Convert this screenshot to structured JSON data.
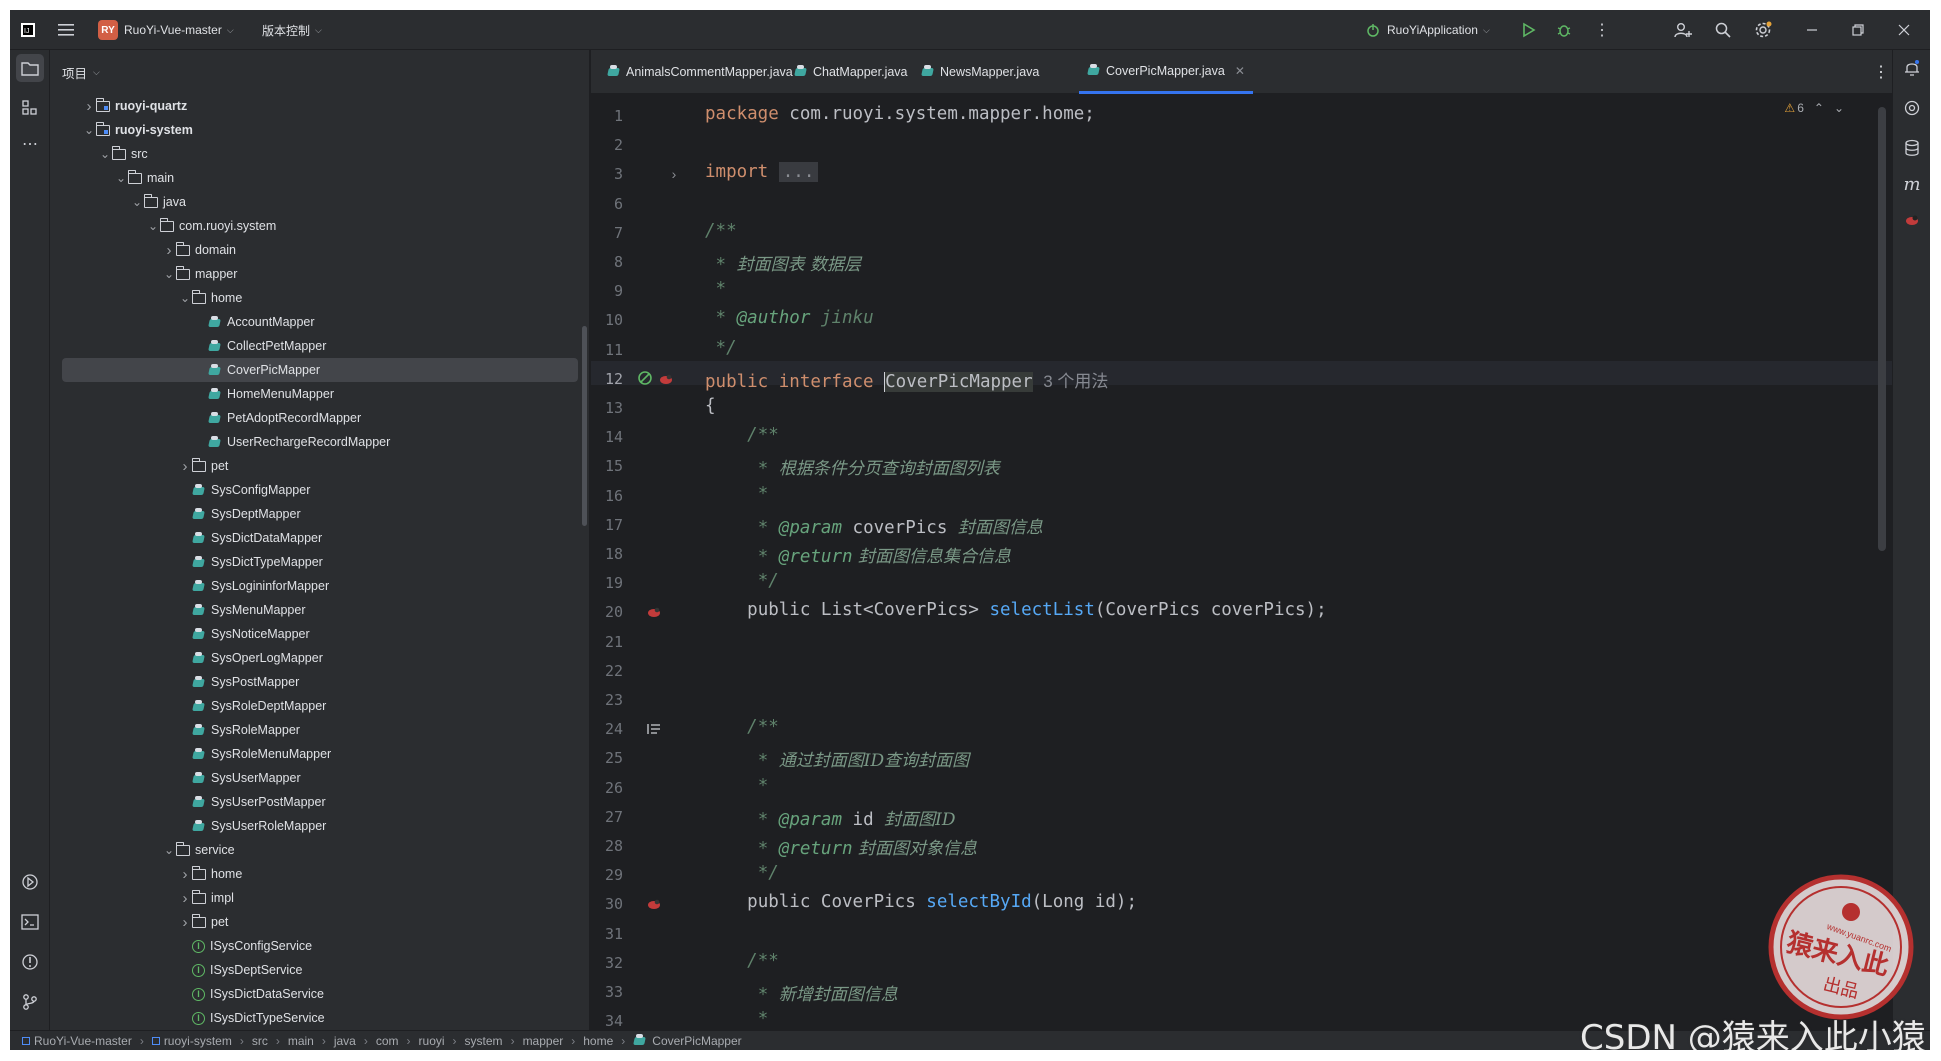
{
  "titlebar": {
    "project_badge": "RY",
    "project_name": "RuoYi-Vue-master",
    "vcs": "版本控制",
    "run_config": "RuoYiApplication"
  },
  "sidebar": {
    "title": "项目"
  },
  "tree": [
    {
      "label": "ruoyi-quartz",
      "depth": 1,
      "kind": "module",
      "arrow": "right",
      "bold": true
    },
    {
      "label": "ruoyi-system",
      "depth": 1,
      "kind": "module",
      "arrow": "down",
      "bold": true
    },
    {
      "label": "src",
      "depth": 2,
      "kind": "folder",
      "arrow": "down"
    },
    {
      "label": "main",
      "depth": 3,
      "kind": "folder",
      "arrow": "down"
    },
    {
      "label": "java",
      "depth": 4,
      "kind": "folder",
      "arrow": "down"
    },
    {
      "label": "com.ruoyi.system",
      "depth": 5,
      "kind": "folder",
      "arrow": "down"
    },
    {
      "label": "domain",
      "depth": 6,
      "kind": "folder",
      "arrow": "right"
    },
    {
      "label": "mapper",
      "depth": 6,
      "kind": "folder",
      "arrow": "down"
    },
    {
      "label": "home",
      "depth": 7,
      "kind": "folder",
      "arrow": "down"
    },
    {
      "label": "AccountMapper",
      "depth": 8,
      "kind": "mapper"
    },
    {
      "label": "CollectPetMapper",
      "depth": 8,
      "kind": "mapper"
    },
    {
      "label": "CoverPicMapper",
      "depth": 8,
      "kind": "mapper",
      "selected": true
    },
    {
      "label": "HomeMenuMapper",
      "depth": 8,
      "kind": "mapper"
    },
    {
      "label": "PetAdoptRecordMapper",
      "depth": 8,
      "kind": "mapper"
    },
    {
      "label": "UserRechargeRecordMapper",
      "depth": 8,
      "kind": "mapper"
    },
    {
      "label": "pet",
      "depth": 7,
      "kind": "folder",
      "arrow": "right"
    },
    {
      "label": "SysConfigMapper",
      "depth": 7,
      "kind": "mapper"
    },
    {
      "label": "SysDeptMapper",
      "depth": 7,
      "kind": "mapper"
    },
    {
      "label": "SysDictDataMapper",
      "depth": 7,
      "kind": "mapper"
    },
    {
      "label": "SysDictTypeMapper",
      "depth": 7,
      "kind": "mapper"
    },
    {
      "label": "SysLogininforMapper",
      "depth": 7,
      "kind": "mapper"
    },
    {
      "label": "SysMenuMapper",
      "depth": 7,
      "kind": "mapper"
    },
    {
      "label": "SysNoticeMapper",
      "depth": 7,
      "kind": "mapper"
    },
    {
      "label": "SysOperLogMapper",
      "depth": 7,
      "kind": "mapper"
    },
    {
      "label": "SysPostMapper",
      "depth": 7,
      "kind": "mapper"
    },
    {
      "label": "SysRoleDeptMapper",
      "depth": 7,
      "kind": "mapper"
    },
    {
      "label": "SysRoleMapper",
      "depth": 7,
      "kind": "mapper"
    },
    {
      "label": "SysRoleMenuMapper",
      "depth": 7,
      "kind": "mapper"
    },
    {
      "label": "SysUserMapper",
      "depth": 7,
      "kind": "mapper"
    },
    {
      "label": "SysUserPostMapper",
      "depth": 7,
      "kind": "mapper"
    },
    {
      "label": "SysUserRoleMapper",
      "depth": 7,
      "kind": "mapper"
    },
    {
      "label": "service",
      "depth": 6,
      "kind": "folder",
      "arrow": "down"
    },
    {
      "label": "home",
      "depth": 7,
      "kind": "folder",
      "arrow": "right"
    },
    {
      "label": "impl",
      "depth": 7,
      "kind": "folder",
      "arrow": "right"
    },
    {
      "label": "pet",
      "depth": 7,
      "kind": "folder",
      "arrow": "right"
    },
    {
      "label": "ISysConfigService",
      "depth": 7,
      "kind": "interface"
    },
    {
      "label": "ISysDeptService",
      "depth": 7,
      "kind": "interface"
    },
    {
      "label": "ISysDictDataService",
      "depth": 7,
      "kind": "interface"
    },
    {
      "label": "ISysDictTypeService",
      "depth": 7,
      "kind": "interface"
    }
  ],
  "tabs": [
    {
      "label": "AnimalsCommentMapper.java"
    },
    {
      "label": "ChatMapper.java"
    },
    {
      "label": "NewsMapper.java"
    },
    {
      "label": "CoverPicMapper.java",
      "active": true
    }
  ],
  "editor": {
    "warnings": "6",
    "line_numbers": [
      "1",
      "2",
      "3",
      "6",
      "7",
      "8",
      "9",
      "10",
      "11",
      "12",
      "13",
      "14",
      "15",
      "16",
      "17",
      "18",
      "19",
      "20",
      "21",
      "22",
      "23",
      "24",
      "25",
      "26",
      "27",
      "28",
      "29",
      "30",
      "31",
      "32",
      "33",
      "34"
    ],
    "code": {
      "pkg_kw": "package",
      "pkg_name": " com.ruoyi.system.mapper.home;",
      "import_kw": "import",
      "import_fold": "...",
      "c_open": "/**",
      "c_star": " *",
      "c1_text": "封面图表 数据层",
      "author_tag": "@author",
      "author_val": " jinku",
      "c_close": " */",
      "public_kw": "public",
      "interface_kw": " interface ",
      "class_name": "CoverPicMapper",
      "usages": "3 个用法",
      "brace_open": "{",
      "m1_desc": "根据条件分页查询封面图列表",
      "param_tag": "@param",
      "m1_param": " coverPics ",
      "m1_param_desc": "封面图信息",
      "return_tag": "@return",
      "m1_return_desc": " 封面图信息集合信息",
      "m1_sig_a": "public List<CoverPics> ",
      "m1_fn": "selectList",
      "m1_sig_b": "(CoverPics coverPics);",
      "m2_desc": "通过封面图ID查询封面图",
      "m2_param": " id ",
      "m2_param_desc": "封面图ID",
      "m2_return_desc": " 封面图对象信息",
      "m2_sig_a": "public CoverPics ",
      "m2_fn": "selectById",
      "m2_sig_b": "(Long id);",
      "m3_desc": "新增封面图信息"
    }
  },
  "breadcrumb": [
    "RuoYi-Vue-master",
    "ruoyi-system",
    "src",
    "main",
    "java",
    "com",
    "ruoyi",
    "system",
    "mapper",
    "home",
    "CoverPicMapper"
  ],
  "watermark": {
    "seal_text": "猿来入此",
    "seal_url": "www.yuanrc.com",
    "seal_sub": "出品",
    "csdn": "CSDN @猿来入此小猿"
  },
  "colors": {
    "accent": "#3574f0",
    "bg": "#1e1f22",
    "panel": "#2b2d30",
    "keyword": "#cf8e6d",
    "function": "#56a8f5",
    "comment": "#5f826b"
  }
}
